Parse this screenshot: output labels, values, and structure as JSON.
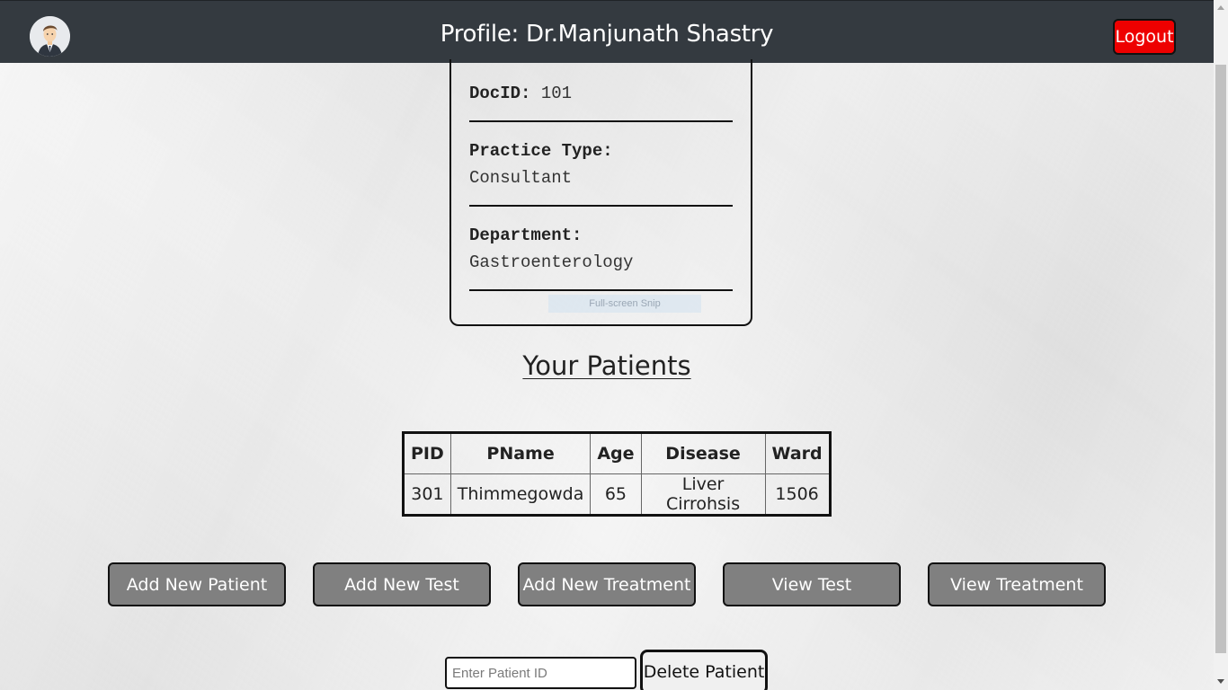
{
  "header": {
    "title": "Profile: Dr.Manjunath Shastry",
    "logout_label": "Logout",
    "avatar_icon": "doctor-avatar-icon"
  },
  "profile": {
    "docid_label": "DocID:",
    "docid_value": "101",
    "practice_label": "Practice Type:",
    "practice_value": "Consultant",
    "department_label": "Department:",
    "department_value": "Gastroenterology",
    "overlay_text": "Full-screen Snip"
  },
  "patients": {
    "heading": "Your Patients",
    "columns": [
      "PID",
      "PName",
      "Age",
      "Disease",
      "Ward"
    ],
    "rows": [
      [
        "301",
        "Thimmegowda",
        "65",
        "Liver Cirrohsis",
        "1506"
      ]
    ]
  },
  "actions": {
    "buttons": [
      "Add New Patient",
      "Add New Test",
      "Add New Treatment",
      "View Test",
      "View Treatment"
    ]
  },
  "delete": {
    "placeholder": "Enter Patient ID",
    "value": "",
    "button_label": "Delete Patient"
  },
  "colors": {
    "header_bg": "#343a40",
    "logout_bg": "#ee0000",
    "action_bg": "#808080",
    "page_bg": "#ebebeb"
  }
}
